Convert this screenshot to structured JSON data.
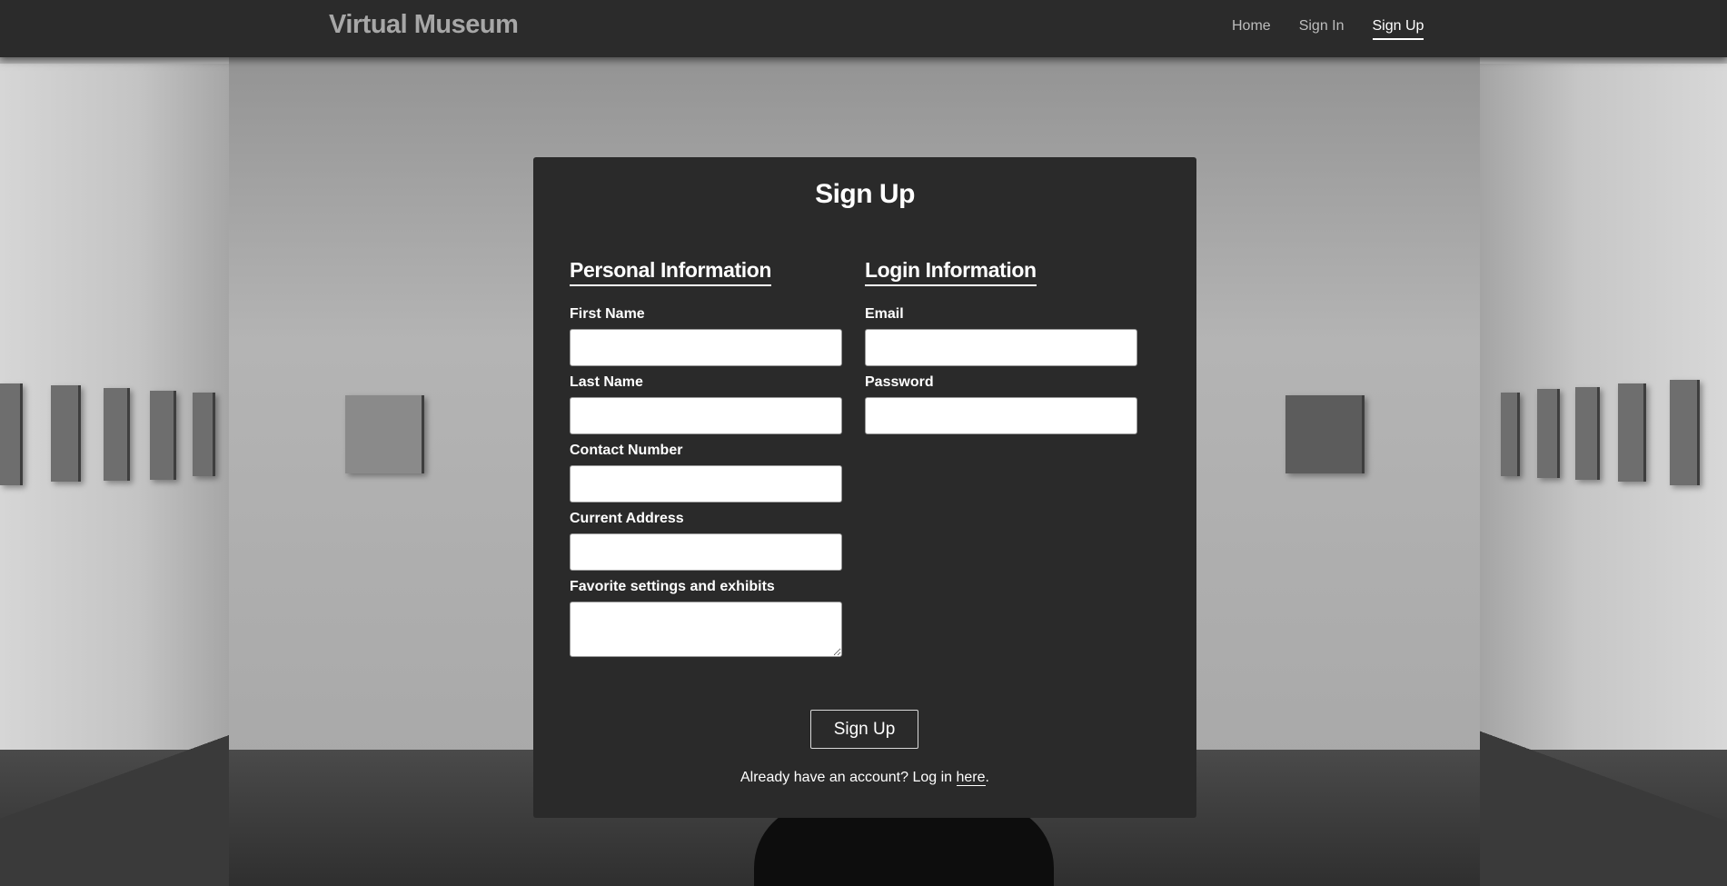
{
  "nav": {
    "brand": "Virtual Museum",
    "links": [
      "Home",
      "Sign In",
      "Sign Up"
    ]
  },
  "form": {
    "title": "Sign Up",
    "personal": {
      "heading": "Personal Information",
      "first_name_label": "First Name",
      "first_name_value": "",
      "last_name_label": "Last Name",
      "last_name_value": "",
      "contact_label": "Contact Number",
      "contact_value": "",
      "address_label": "Current Address",
      "address_value": "",
      "favorites_label": "Favorite settings and exhibits",
      "favorites_value": ""
    },
    "login": {
      "heading": "Login Information",
      "email_label": "Email",
      "email_value": "",
      "password_label": "Password",
      "password_value": ""
    },
    "submit_label": "Sign Up",
    "footer_prefix": "Already have an account? Log in ",
    "footer_link": "here",
    "footer_suffix": "."
  }
}
